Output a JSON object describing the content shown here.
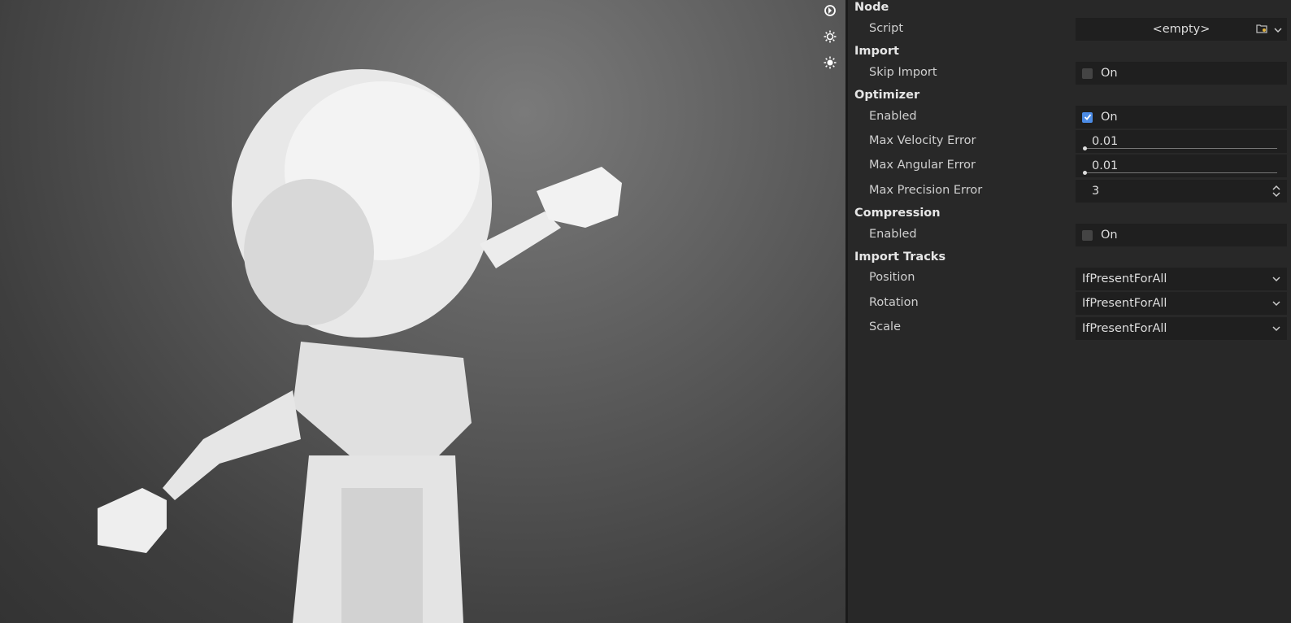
{
  "viewport": {
    "tools": [
      "orbit-icon",
      "sun-icon",
      "environment-icon"
    ]
  },
  "inspector": {
    "node": {
      "heading": "Node",
      "script_label": "Script",
      "script_value": "<empty>"
    },
    "import": {
      "heading": "Import",
      "skip_label": "Skip Import",
      "skip_checked": false,
      "skip_text": "On"
    },
    "optimizer": {
      "heading": "Optimizer",
      "enabled_label": "Enabled",
      "enabled_checked": true,
      "enabled_text": "On",
      "max_velocity_label": "Max Velocity Error",
      "max_velocity_value": "0.01",
      "max_angular_label": "Max Angular Error",
      "max_angular_value": "0.01",
      "max_precision_label": "Max Precision Error",
      "max_precision_value": "3"
    },
    "compression": {
      "heading": "Compression",
      "enabled_label": "Enabled",
      "enabled_checked": false,
      "enabled_text": "On"
    },
    "tracks": {
      "heading": "Import Tracks",
      "position_label": "Position",
      "position_value": "IfPresentForAll",
      "rotation_label": "Rotation",
      "rotation_value": "IfPresentForAll",
      "scale_label": "Scale",
      "scale_value": "IfPresentForAll"
    }
  },
  "colors": {
    "accent": "#4c8ce6",
    "panel_bg": "#282828",
    "field_bg": "#1f1f1f"
  }
}
